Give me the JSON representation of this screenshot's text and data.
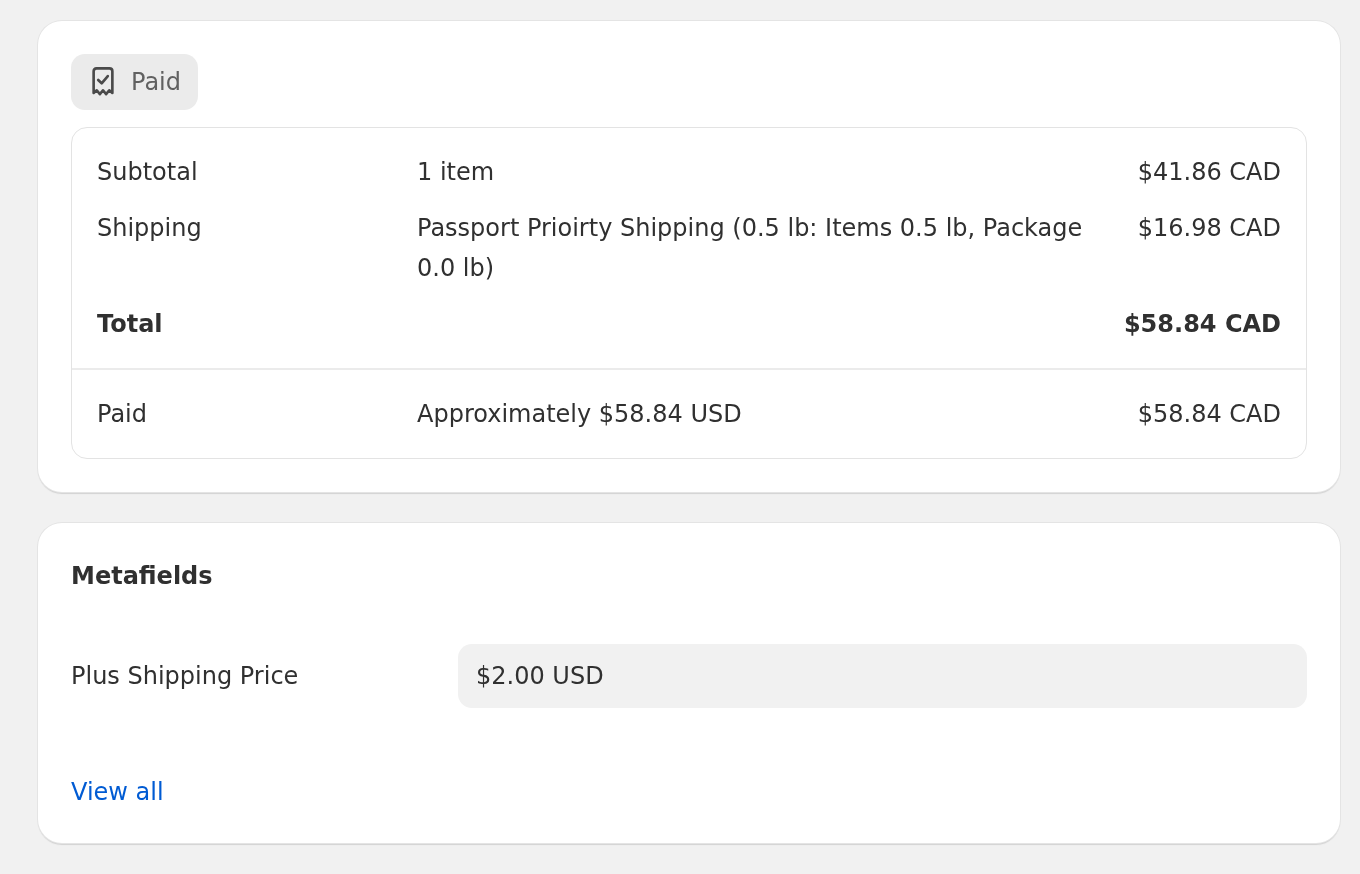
{
  "payment": {
    "status_badge": {
      "label": "Paid"
    },
    "summary": [
      {
        "kind": "line",
        "label": "Subtotal",
        "description": "1 item",
        "amount": "$41.86 CAD"
      },
      {
        "kind": "line",
        "label": "Shipping",
        "description": "Passport Prioirty Shipping (0.5 lb: Items 0.5 lb, Package 0.0 lb)",
        "amount": "$16.98 CAD"
      },
      {
        "kind": "total",
        "label": "Total",
        "amount": "$58.84 CAD"
      }
    ],
    "paid": {
      "label": "Paid",
      "description": "Approximately $58.84 USD",
      "amount": "$58.84 CAD"
    }
  },
  "metafields": {
    "title": "Metafields",
    "fields": [
      {
        "label": "Plus Shipping Price",
        "value": "$2.00 USD"
      }
    ],
    "link": "View all"
  }
}
